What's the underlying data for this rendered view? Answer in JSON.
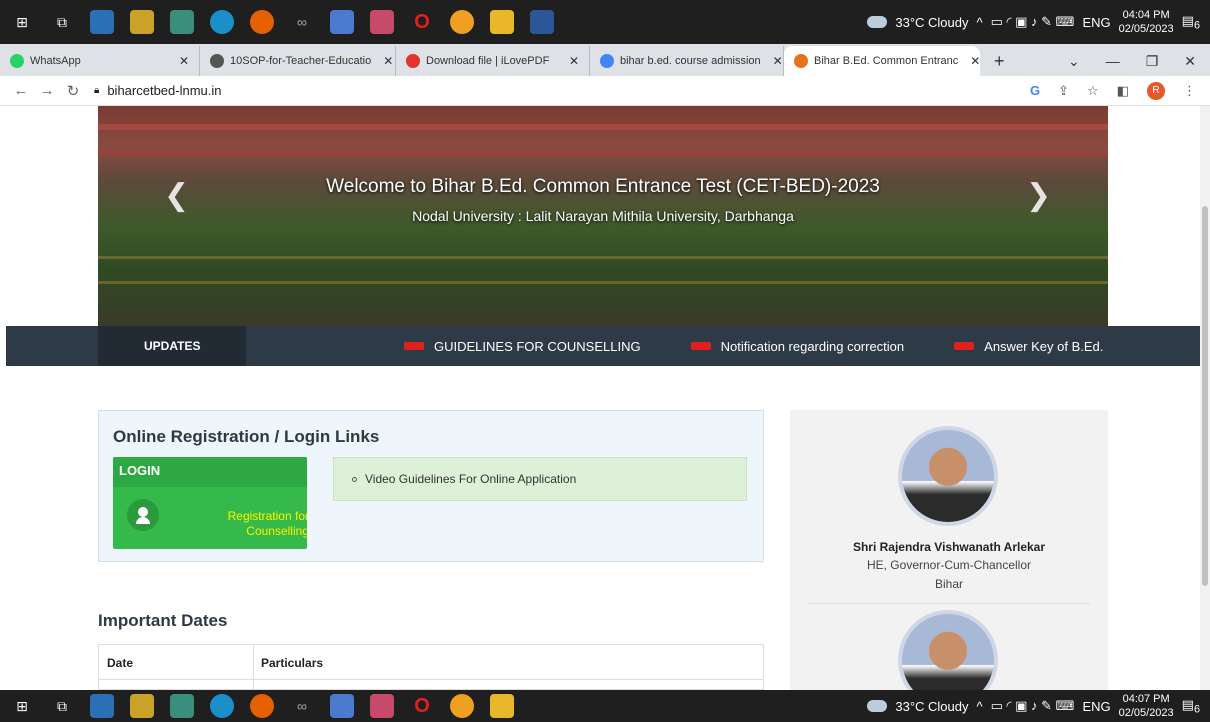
{
  "taskbar_top": {
    "weather": "33°C Cloudy",
    "lang": "ENG",
    "time": "04:04 PM",
    "date": "02/05/2023",
    "notif_count": "6"
  },
  "taskbar_bottom": {
    "weather": "33°C Cloudy",
    "lang": "ENG",
    "time": "04:07 PM",
    "date": "02/05/2023",
    "notif_count": "6"
  },
  "tabs": [
    {
      "label": "WhatsApp",
      "color": "#25d366"
    },
    {
      "label": "10SOP-for-Teacher-Educatio",
      "color": "#555555"
    },
    {
      "label": "Download file | iLovePDF",
      "color": "#e5322d"
    },
    {
      "label": "bihar b.ed. course admission",
      "color": "#4285f4"
    },
    {
      "label": "Bihar B.Ed. Common Entranc",
      "color": "#e8711b"
    }
  ],
  "address": {
    "url": "biharcetbed-lnmu.in",
    "profile_initial": "R"
  },
  "banner": {
    "title": "Welcome to Bihar B.Ed. Common Entrance Test (CET-BED)-2023",
    "subtitle": "Nodal University : Lalit Narayan Mithila University, Darbhanga"
  },
  "updates": {
    "label": "UPDATES",
    "items": [
      "GUIDELINES FOR COUNSELLING",
      "Notification regarding correction",
      "Answer Key of B.Ed."
    ]
  },
  "registration": {
    "title": "Online Registration / Login Links",
    "login_header": "LOGIN",
    "login_link": "Registration for Counselling",
    "video_link": "Video Guidelines For Online Application"
  },
  "important_dates": {
    "title": "Important Dates",
    "col_date": "Date",
    "col_particulars": "Particulars"
  },
  "sidebar": {
    "person1_name": "Shri Rajendra Vishwanath Arlekar",
    "person1_role": "HE, Governor-Cum-Chancellor",
    "person1_state": "Bihar"
  }
}
